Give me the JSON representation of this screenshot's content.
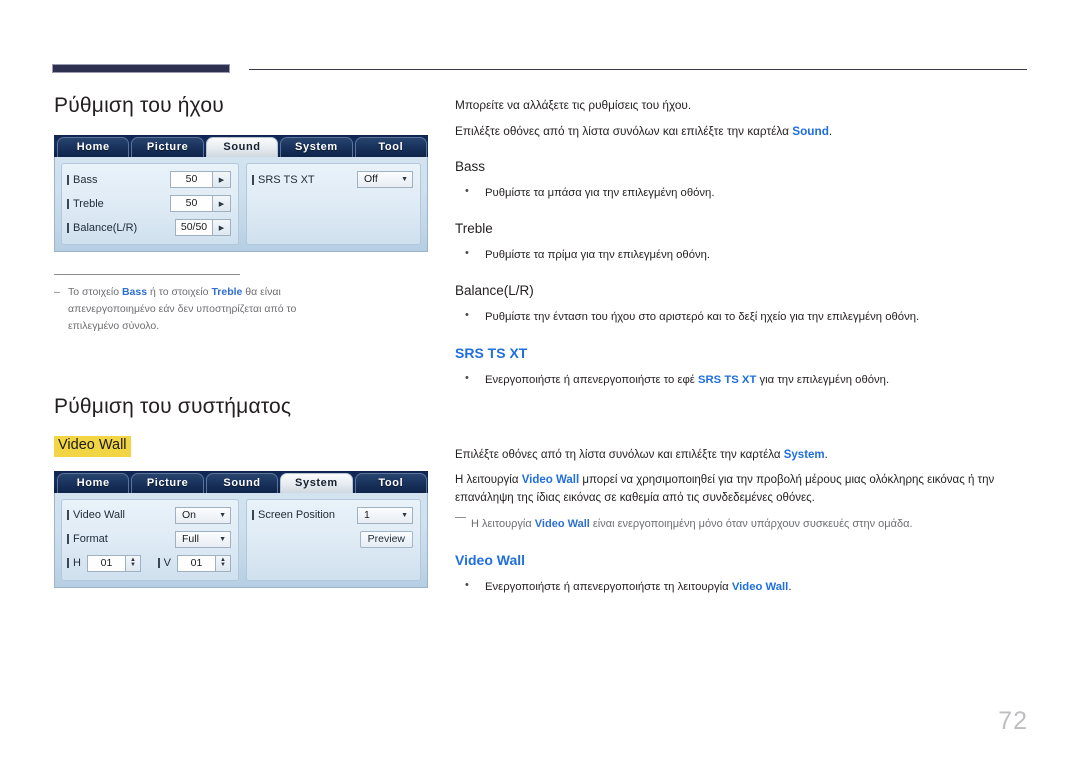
{
  "page": {
    "number": "72",
    "accent_color": "#1f6fe0",
    "highlight_color": "#f2d544",
    "rule_color": "#2e3050"
  },
  "sound_section": {
    "title": "Ρύθμιση του ήχου",
    "intro_1": "Μπορείτε να αλλάξετε τις ρυθμίσεις του ήχου.",
    "intro_2_pre": "Επιλέξτε οθόνες από τη λίστα συνόλων και επιλέξτε την καρτέλα ",
    "intro_2_link": "Sound",
    "intro_2_post": ".",
    "subsections": [
      {
        "heading": "Bass",
        "bullet": "Ρυθμίστε τα μπάσα για την επιλεγμένη οθόνη."
      },
      {
        "heading": "Treble",
        "bullet": "Ρυθμίστε τα πρίμα για την επιλεγμένη οθόνη."
      },
      {
        "heading": "Balance(L/R)",
        "bullet": "Ρυθμίστε την έντασn του ήχου στο αριστερό και το δεξί ηχείο για την επιλεγμένη οθόνη."
      }
    ],
    "srs": {
      "heading": "SRS TS XT",
      "bullet_pre": "Ενεργοποιήστε ή απενεργοποιήστε το εφέ ",
      "bullet_link": "SRS TS XT",
      "bullet_post": " για την επιλεγμένη οθόνη."
    },
    "footnote": {
      "dash": "–",
      "pre": "Το στοιχείο ",
      "link1": "Bass",
      "mid": " ή το στοιχείο ",
      "link2": "Treble",
      "post": " θα είναι απενεργοποιημένο εάν δεν υποστηρίζεται από το επιλεγμένο σύνολο."
    }
  },
  "sound_ui": {
    "tabs": [
      {
        "label": "Home",
        "active": false
      },
      {
        "label": "Picture",
        "active": false
      },
      {
        "label": "Sound",
        "active": true
      },
      {
        "label": "System",
        "active": false
      },
      {
        "label": "Tool",
        "active": false
      }
    ],
    "rows_left": [
      {
        "label": "Bass",
        "value": "50",
        "control": "stepper",
        "arrow": "▶"
      },
      {
        "label": "Treble",
        "value": "50",
        "control": "stepper",
        "arrow": "▶"
      },
      {
        "label": "Balance(L/R)",
        "value": "50/50",
        "control": "stepper",
        "arrow": "▶"
      }
    ],
    "rows_right": [
      {
        "label": "SRS TS XT",
        "value": "Off",
        "control": "dropdown",
        "arrow": "▼"
      }
    ]
  },
  "system_section": {
    "title": "Ρύθμιση του συστήματος",
    "highlight_label": "Video Wall",
    "intro_pre": "Επιλέξτε οθόνες από τη λίστα συνόλων και επιλέξτε την καρτέλα ",
    "intro_link": "System",
    "intro_post": ".",
    "body_pre": "Η λειτουργία ",
    "body_link": "Video Wall",
    "body_post": " μπορεί να χρησιμοποιηθεί για την προβολή μέρους μιας ολόκληρης εικόνας ή την επανάληψη της ίδιας εικόνας σε καθεμία από τις συνδεδεμένες οθόνες.",
    "note_pre": "Η λειτουργία ",
    "note_link": "Video Wall",
    "note_post": " είναι ενεργοποιημένη μόνο όταν υπάρχουν συσκευές στην ομάδα.",
    "sub_heading": "Video Wall",
    "sub_bullet_pre": "Ενεργοποιήστε ή απενεργοποιήστε τη λειτουργία ",
    "sub_bullet_link": "Video Wall",
    "sub_bullet_post": "."
  },
  "system_ui": {
    "tabs": [
      {
        "label": "Home",
        "active": false
      },
      {
        "label": "Picture",
        "active": false
      },
      {
        "label": "Sound",
        "active": false
      },
      {
        "label": "System",
        "active": true
      },
      {
        "label": "Tool",
        "active": false
      }
    ],
    "video_wall": {
      "label": "Video Wall",
      "value": "On",
      "arrow": "▼"
    },
    "format": {
      "label": "Format",
      "value": "Full",
      "arrow": "▼"
    },
    "h_field": {
      "label": "H",
      "value": "01"
    },
    "v_field": {
      "label": "V",
      "value": "01"
    },
    "screen_position": {
      "label": "Screen Position",
      "value": "1",
      "arrow": "▼"
    },
    "preview_button": "Preview",
    "spinner_up": "▲",
    "spinner_down": "▼"
  }
}
